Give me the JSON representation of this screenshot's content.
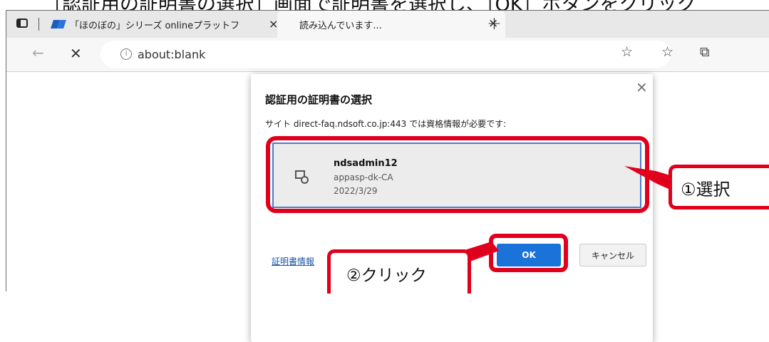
{
  "header_cut_text": "［認証用の証明書の選択］画面で証明書を選択し、［OK］ボタンをクリック",
  "browser": {
    "tabs": [
      {
        "title": "「ほのぼの」シリーズ onlineプラットフォ"
      },
      {
        "title": "読み込んでいます..."
      }
    ],
    "close_glyph": "×",
    "new_tab_glyph": "+",
    "address_bar": {
      "url": "about:blank",
      "info_glyph": "i"
    },
    "toolbar_icons": {
      "back": "←",
      "stop": "✕",
      "favorite_add": "☆",
      "favorites": "☆",
      "collections": "⧉"
    }
  },
  "dialog": {
    "title": "認証用の証明書の選択",
    "description": "サイト direct-faq.ndsoft.co.jp:443 では資格情報が必要です:",
    "close_glyph": "×",
    "certificate": {
      "name": "ndsadmin12",
      "issuer": "appasp-dk-CA",
      "date": "2022/3/29",
      "icon": "certificate-icon"
    },
    "certificate_info_link": "証明書情報",
    "ok_button": "OK",
    "cancel_button": "キャンセル"
  },
  "annotations": {
    "step1": "①選択",
    "step2": "②クリック",
    "highlight_color": "#e0001b"
  },
  "colors": {
    "accent_blue": "#1a73d9",
    "selection_border": "#4a7ec9"
  }
}
